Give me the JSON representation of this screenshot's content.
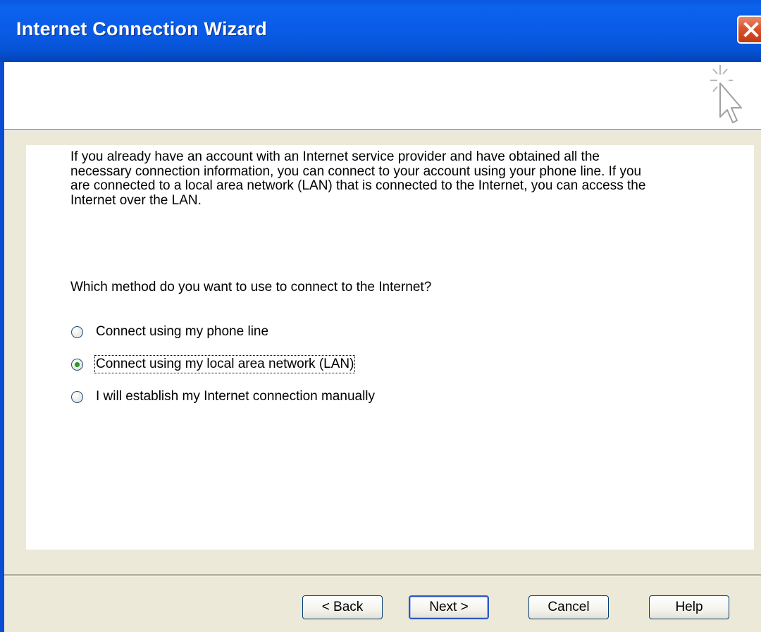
{
  "window": {
    "title": "Internet Connection Wizard",
    "close_icon": "close-icon"
  },
  "header": {
    "icon": "wizard-cursor-sparkle-icon"
  },
  "content": {
    "intro_text": "If you already have an account with an Internet service provider and have obtained all the necessary connection information, you can connect to your account using your phone line. If you are connected to a local area network (LAN) that is connected to the Internet, you can access the Internet over the LAN.",
    "question": "Which method do you want to use to connect to the Internet?",
    "options": [
      {
        "label": "Connect using my phone line",
        "checked": false
      },
      {
        "label": "Connect using my local area network (LAN)",
        "checked": true
      },
      {
        "label": "I will establish my Internet connection manually",
        "checked": false
      }
    ]
  },
  "buttons": {
    "back": "< Back",
    "next": "Next >",
    "cancel": "Cancel",
    "help": "Help"
  },
  "colors": {
    "titlebar": "#0A58E0",
    "face": "#ECE9D8",
    "close": "#D9532C"
  }
}
